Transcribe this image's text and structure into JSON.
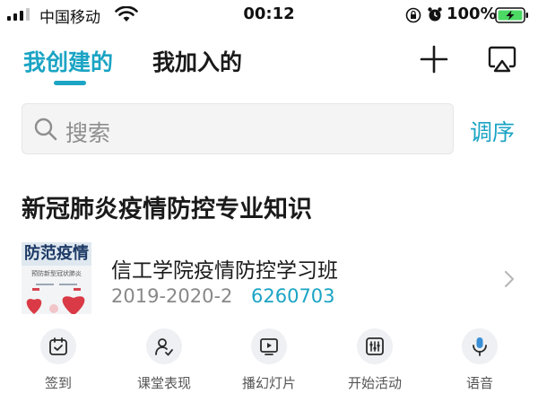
{
  "status_bar": {
    "carrier": "中国移动",
    "time": "00:12",
    "battery_percent": "100%",
    "icons": [
      "signal-icon",
      "wifi-icon",
      "orientation-lock-icon",
      "alarm-icon",
      "battery-charging-icon"
    ]
  },
  "header": {
    "tabs": [
      {
        "label": "我创建的",
        "active": true
      },
      {
        "label": "我加入的",
        "active": false
      }
    ],
    "icons": [
      "plus-icon",
      "screen-cast-icon"
    ]
  },
  "search": {
    "placeholder": "搜索",
    "sort_label": "调序"
  },
  "section": {
    "title": "新冠肺炎疫情防控专业知识"
  },
  "course": {
    "thumbnail_title": "防范疫情",
    "thumbnail_subtitle": "预防新型冠状肺炎",
    "name": "信工学院疫情防控学习班",
    "term": "2019-2020-2",
    "code": "6260703"
  },
  "actions": [
    {
      "label": "签到",
      "icon": "check-in-icon"
    },
    {
      "label": "课堂表现",
      "icon": "classroom-performance-icon"
    },
    {
      "label": "播幻灯片",
      "icon": "slideshow-icon"
    },
    {
      "label": "开始活动",
      "icon": "activity-sliders-icon"
    },
    {
      "label": "语音",
      "icon": "microphone-icon"
    }
  ],
  "colors": {
    "accent": "#1ba4c4",
    "text": "#1a1a1a",
    "muted": "#888888",
    "battery_fill": "#4cd964"
  }
}
